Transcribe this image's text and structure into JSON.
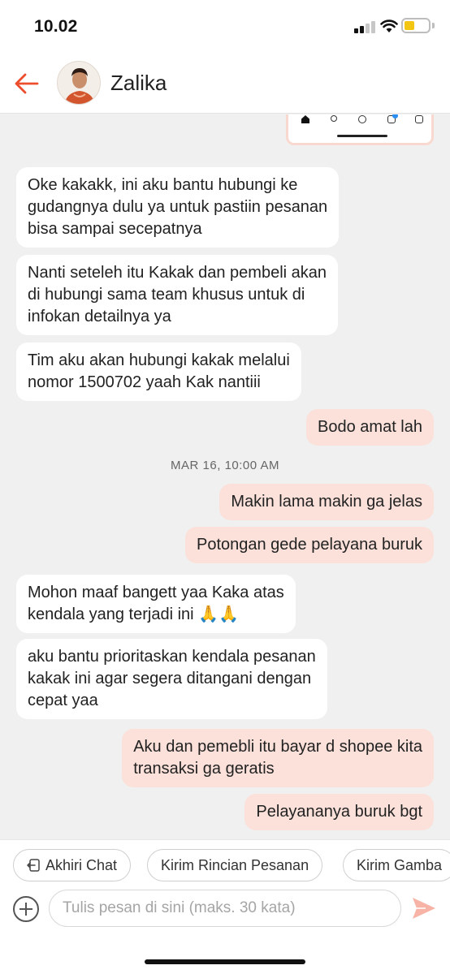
{
  "status_bar": {
    "time": "10.02",
    "battery_color": "#f3c614"
  },
  "header": {
    "contact_name": "Zalika",
    "back_icon": "back-arrow-icon",
    "accent_color": "#ee4d2d"
  },
  "messages": [
    {
      "side": "in",
      "text": "Oke kakakk, ini aku bantu hubungi ke\ngudangnya dulu ya untuk pastiin pesanan\nbisa sampai secepatnya"
    },
    {
      "side": "in",
      "text": "Nanti seteleh itu Kakak dan pembeli akan\ndi hubungi sama team khusus untuk di\ninfokan detailnya ya"
    },
    {
      "side": "in",
      "text": "Tim aku akan hubungi kakak melalui\nnomor 1500702 yaah Kak nantiii"
    },
    {
      "side": "out",
      "text": "Bodo amat lah"
    },
    {
      "side": "out",
      "text": "Makin lama makin ga jelas"
    },
    {
      "side": "out",
      "text": "Potongan gede pelayana buruk"
    },
    {
      "side": "in",
      "text": "Mohon maaf bangett yaa Kaka atas\nkendala yang terjadi ini 🙏🙏"
    },
    {
      "side": "in",
      "text": "aku bantu prioritaskan kendala pesanan\nkakak ini agar segera ditangani dengan\ncepat yaa"
    },
    {
      "side": "out",
      "text": "Aku dan pemebli itu bayar d shopee kita\ntransaksi ga geratis"
    },
    {
      "side": "out",
      "text": "Pelayananya buruk bgt"
    }
  ],
  "date_separator": "MAR 16, 10:00 AM",
  "quick_replies": [
    {
      "label": "Akhiri Chat",
      "icon": "exit-icon"
    },
    {
      "label": "Kirim Rincian Pesanan"
    },
    {
      "label": "Kirim Gamba"
    }
  ],
  "composer": {
    "placeholder": "Tulis pesan di sini (maks. 30 kata)",
    "send_color": "#f7b3a5"
  }
}
